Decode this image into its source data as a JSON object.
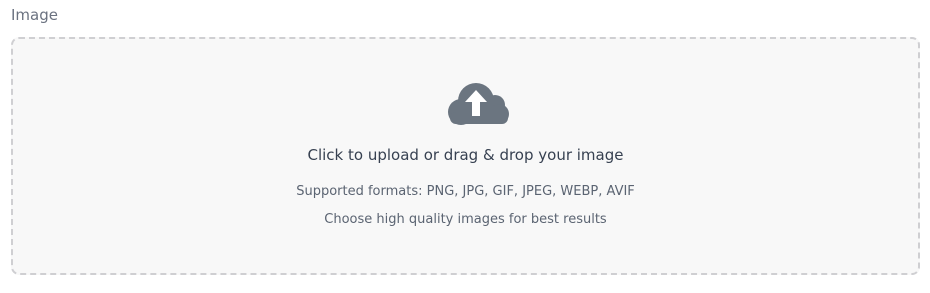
{
  "field": {
    "label": "Image"
  },
  "dropzone": {
    "icon": "cloud-upload-icon",
    "primary_text": "Click to upload or drag & drop your image",
    "formats_text": "Supported formats: PNG, JPG, GIF, JPEG, WEBP, AVIF",
    "hint_text": "Choose high quality images for best results"
  },
  "colors": {
    "icon": "#6b7580",
    "border": "#cfcfd2",
    "background": "#f8f8f8"
  }
}
